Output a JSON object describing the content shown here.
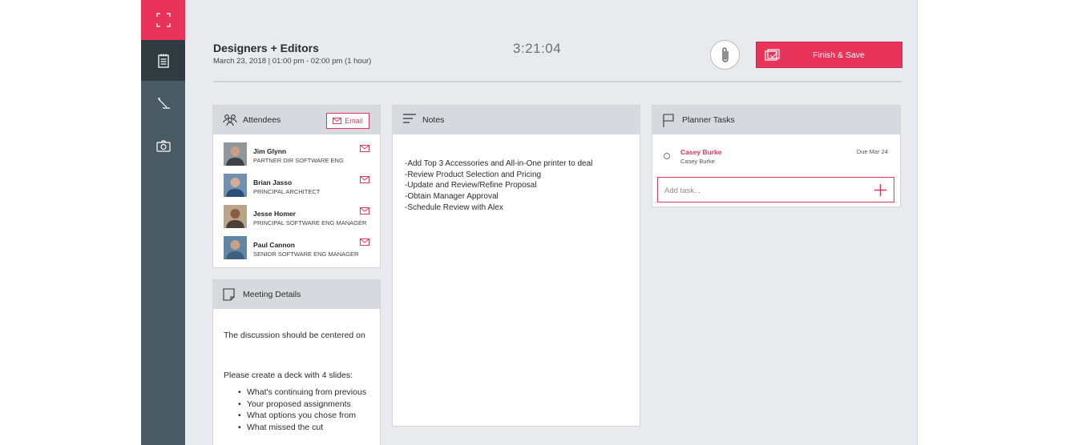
{
  "meeting": {
    "title": "Designers + Editors",
    "subtitle": "March 23, 2018 | 01:00 pm - 02:00 pm (1 hour)",
    "timer": "3:21:04"
  },
  "toolbar": {
    "finish_label": "Finish & Save"
  },
  "attendees": {
    "title": "Attendees",
    "email_label": "Email",
    "people": [
      {
        "name": "Jim Glynn",
        "role": "PARTNER DIR SOFTWARE ENG"
      },
      {
        "name": "Brian Jasso",
        "role": "PRINCIPAL ARCHITECT"
      },
      {
        "name": "Jesse Homer",
        "role": "PRINCIPAL SOFTWARE ENG MANAGER"
      },
      {
        "name": "Paul Cannon",
        "role": "SENIOR SOFTWARE ENG MANAGER"
      }
    ]
  },
  "details": {
    "title": "Meeting Details",
    "paragraph1": "The discussion should be centered on",
    "paragraph2": "Please create a deck with 4 slides:",
    "bullets": [
      "What's continuing from previous",
      "Your proposed assignments",
      "What options you chose from",
      "What missed the cut"
    ]
  },
  "notes": {
    "title": "Notes",
    "lines": [
      "-Add Top 3 Accessories and All-in-One printer to deal",
      "-Review Product Selection and Pricing",
      "-Update and Review/Refine Proposal",
      "-Obtain Manager Approval",
      "-Schedule Review with Alex"
    ]
  },
  "planner": {
    "title": "Planner Tasks",
    "task": {
      "name": "Casey Burke",
      "assignee": "Casey Burke",
      "due": "Due Mar 24"
    },
    "add_placeholder": "Add task..."
  },
  "colors": {
    "accent": "#e8345a",
    "rail": "#4a5a64",
    "rail_active": "#2f3a41",
    "background": "#e8eaed"
  }
}
